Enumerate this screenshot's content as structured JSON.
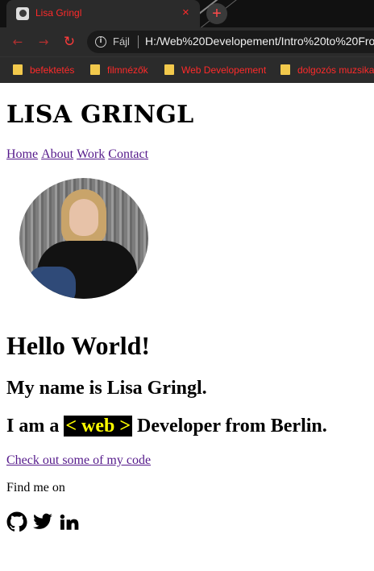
{
  "browser": {
    "tab": {
      "title": "Lisa Gringl",
      "close": "×"
    },
    "new_tab": "+",
    "nav": {
      "back": "←",
      "forward": "→",
      "reload": "↻"
    },
    "address": {
      "scheme": "Fájl",
      "url": "H:/Web%20Developement/Intro%20to%20Fro"
    },
    "bookmarks": [
      {
        "label": "befektetés"
      },
      {
        "label": "filmnézők"
      },
      {
        "label": "Web Developement"
      },
      {
        "label": "dolgozós muzsika"
      }
    ]
  },
  "page": {
    "site_title": "LISA GRINGL",
    "nav": [
      "Home",
      "About",
      "Work",
      "Contact"
    ],
    "heading": "Hello World!",
    "intro": "My name is Lisa Gringl.",
    "role_prefix": "I am a",
    "role_highlight": "< web >",
    "role_suffix": "Developer from Berlin.",
    "code_link": "Check out some of my code",
    "find_me": "Find me on",
    "socials": [
      "github-icon",
      "twitter-icon",
      "linkedin-icon"
    ]
  }
}
